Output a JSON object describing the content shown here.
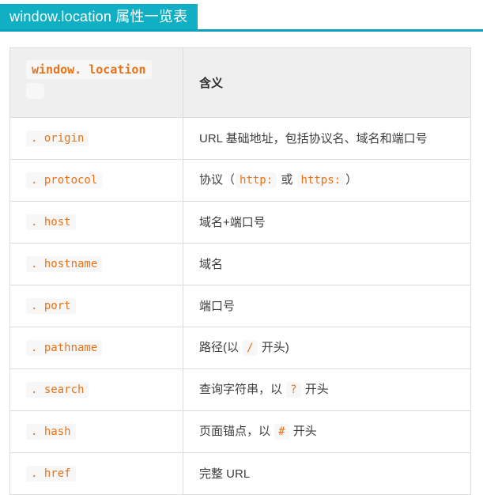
{
  "banner": {
    "title": "window.location 属性一览表",
    "bg_color": "#10AFC4",
    "text_color": "#ffffff",
    "rule_color": "#0C9FBE"
  },
  "table": {
    "header": {
      "property_code": "window. location",
      "property_blank": " ",
      "meaning": "含义"
    },
    "rows": [
      {
        "property": ". origin",
        "desc_parts": [
          {
            "type": "text",
            "value": "URL 基础地址，包括协议名、域名和端口号"
          }
        ]
      },
      {
        "property": ". protocol",
        "desc_parts": [
          {
            "type": "text",
            "value": "协议（"
          },
          {
            "type": "code",
            "value": "http:"
          },
          {
            "type": "text",
            "value": " 或 "
          },
          {
            "type": "code",
            "value": "https:"
          },
          {
            "type": "text",
            "value": "）"
          }
        ]
      },
      {
        "property": ". host",
        "desc_parts": [
          {
            "type": "text",
            "value": "域名+端口号"
          }
        ]
      },
      {
        "property": ". hostname",
        "desc_parts": [
          {
            "type": "text",
            "value": "域名"
          }
        ]
      },
      {
        "property": ". port",
        "desc_parts": [
          {
            "type": "text",
            "value": "端口号"
          }
        ]
      },
      {
        "property": ". pathname",
        "desc_parts": [
          {
            "type": "text",
            "value": "路径(以 "
          },
          {
            "type": "code",
            "value": "/"
          },
          {
            "type": "text",
            "value": " 开头)"
          }
        ]
      },
      {
        "property": ". search",
        "desc_parts": [
          {
            "type": "text",
            "value": "查询字符串，以 "
          },
          {
            "type": "code",
            "value": "?"
          },
          {
            "type": "text",
            "value": " 开头"
          }
        ]
      },
      {
        "property": ". hash",
        "desc_parts": [
          {
            "type": "text",
            "value": "页面锚点，以 "
          },
          {
            "type": "code",
            "value": "#"
          },
          {
            "type": "text",
            "value": " 开头"
          }
        ]
      },
      {
        "property": ". href",
        "desc_parts": [
          {
            "type": "text",
            "value": "完整 URL"
          }
        ]
      }
    ]
  },
  "colors": {
    "code_text": "#E8731A",
    "code_bg": "#F7F7F7",
    "table_border": "#dcdcdc",
    "header_bg": "#EFEFEF",
    "body_text": "#3d3d3d"
  }
}
